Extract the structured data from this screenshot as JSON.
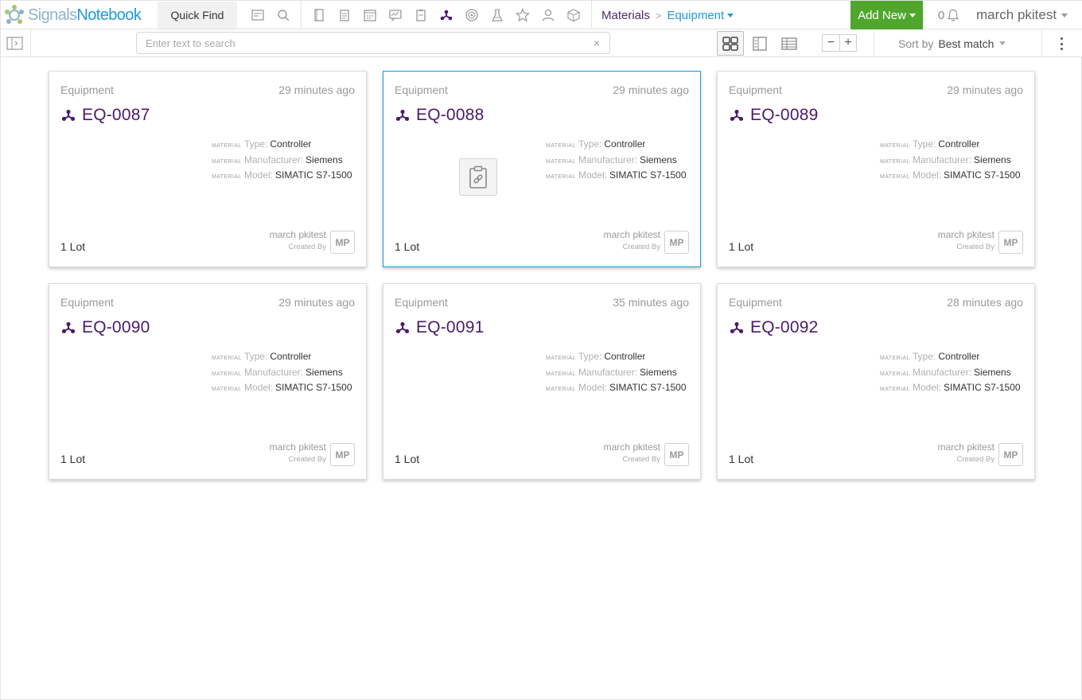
{
  "app": {
    "logo_part1": "Signals",
    "logo_part2": "Notebook",
    "quick_find": "Quick Find",
    "toolbar_icons": [
      "notebook-tile-icon",
      "search-icon",
      "notebook-icon",
      "experiment-icon",
      "calendar-icon",
      "chat-icon",
      "clipboard-icon",
      "materials-icon",
      "biology-icon",
      "flask-icon",
      "star-icon",
      "user-icon",
      "box-icon"
    ],
    "accent": "#1f9bd7",
    "brand_purple": "#4b1a6b",
    "add_new_color": "#4fa62c"
  },
  "breadcrumb": {
    "root": "Materials",
    "current": "Equipment"
  },
  "header": {
    "add_new": "Add New",
    "notification_count": "0",
    "user_name": "march pkitest"
  },
  "toolbar": {
    "search_placeholder": "Enter text to search",
    "search_value": "",
    "clear_glyph": "×",
    "zoom_out": "−",
    "zoom_in": "+",
    "sort_label": "Sort by",
    "sort_value": "Best match"
  },
  "cards": [
    {
      "category": "Equipment",
      "time": "29 minutes ago",
      "id": "EQ-0087",
      "tag": "MATERIAL",
      "type_key": "Type:",
      "type_val": "Controller",
      "mfr_key": "Manufacturer:",
      "mfr_val": "Siemens",
      "model_key": "Model:",
      "model_val": "SIMATIC S7-1500",
      "lot": "1 Lot",
      "creator": "march pkitest",
      "creator_role": "Created By",
      "initials": "MP",
      "selected": false,
      "has_image": false
    },
    {
      "category": "Equipment",
      "time": "29 minutes ago",
      "id": "EQ-0088",
      "tag": "MATERIAL",
      "type_key": "Type:",
      "type_val": "Controller",
      "mfr_key": "Manufacturer:",
      "mfr_val": "Siemens",
      "model_key": "Model:",
      "model_val": "SIMATIC S7-1500",
      "lot": "1 Lot",
      "creator": "march pkitest",
      "creator_role": "Created By",
      "initials": "MP",
      "selected": true,
      "has_image": true
    },
    {
      "category": "Equipment",
      "time": "29 minutes ago",
      "id": "EQ-0089",
      "tag": "MATERIAL",
      "type_key": "Type:",
      "type_val": "Controller",
      "mfr_key": "Manufacturer:",
      "mfr_val": "Siemens",
      "model_key": "Model:",
      "model_val": "SIMATIC S7-1500",
      "lot": "1 Lot",
      "creator": "march pkitest",
      "creator_role": "Created By",
      "initials": "MP",
      "selected": false,
      "has_image": false
    },
    {
      "category": "Equipment",
      "time": "29 minutes ago",
      "id": "EQ-0090",
      "tag": "MATERIAL",
      "type_key": "Type:",
      "type_val": "Controller",
      "mfr_key": "Manufacturer:",
      "mfr_val": "Siemens",
      "model_key": "Model:",
      "model_val": "SIMATIC S7-1500",
      "lot": "1 Lot",
      "creator": "march pkitest",
      "creator_role": "Created By",
      "initials": "MP",
      "selected": false,
      "has_image": false
    },
    {
      "category": "Equipment",
      "time": "35 minutes ago",
      "id": "EQ-0091",
      "tag": "MATERIAL",
      "type_key": "Type:",
      "type_val": "Controller",
      "mfr_key": "Manufacturer:",
      "mfr_val": "Siemens",
      "model_key": "Model:",
      "model_val": "SIMATIC S7-1500",
      "lot": "1 Lot",
      "creator": "march pkitest",
      "creator_role": "Created By",
      "initials": "MP",
      "selected": false,
      "has_image": false
    },
    {
      "category": "Equipment",
      "time": "28 minutes ago",
      "id": "EQ-0092",
      "tag": "MATERIAL",
      "type_key": "Type:",
      "type_val": "Controller",
      "mfr_key": "Manufacturer:",
      "mfr_val": "Siemens",
      "model_key": "Model:",
      "model_val": "SIMATIC S7-1500",
      "lot": "1 Lot",
      "creator": "march pkitest",
      "creator_role": "Created By",
      "initials": "MP",
      "selected": false,
      "has_image": false
    }
  ]
}
